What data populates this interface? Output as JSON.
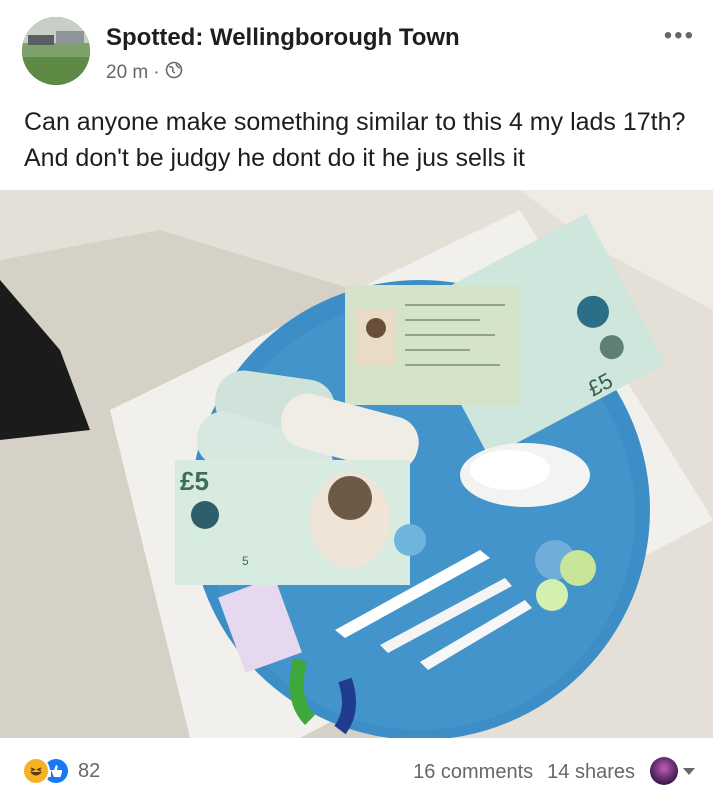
{
  "post": {
    "group_name": "Spotted: Wellingborough Town",
    "time": "20 m",
    "separator": "·",
    "text": "Can anyone make something similar to this 4 my lads 17th? And don't be judgy he dont do it he jus sells it"
  },
  "photo": {
    "note_label": "£5",
    "note_label_rotated": "£5",
    "note_value_small": "5"
  },
  "footer": {
    "reaction_count": "82",
    "comments": "16 comments",
    "shares": "14 shares"
  },
  "icons": {
    "more": "more-options-icon",
    "audience": "globe-icon",
    "reaction_1": "haha-reaction-icon",
    "reaction_2": "like-reaction-icon",
    "viewer": "viewer-avatar-icon",
    "dropdown": "chevron-down-icon"
  },
  "colors": {
    "cake": "#3e8fc6",
    "note": "#cfe6dc",
    "secondary_text": "#65676b",
    "like": "#1877f2",
    "haha": "#f7b125"
  }
}
